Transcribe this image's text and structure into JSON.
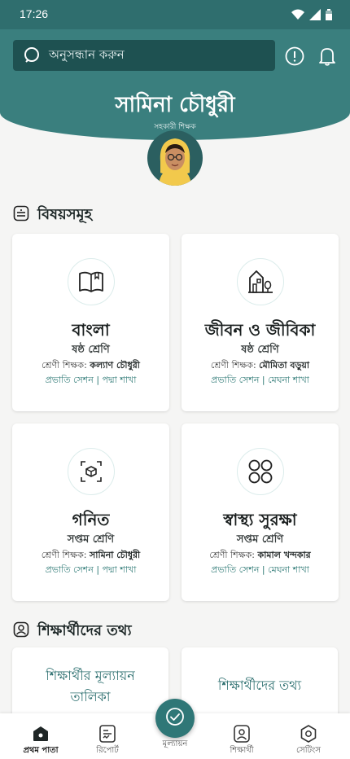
{
  "status": {
    "time": "17:26"
  },
  "header": {
    "search_placeholder": "অনুসন্ধান করুন",
    "user_name": "সামিনা চৌধুরী",
    "user_role": "সহকারী শিক্ষক"
  },
  "subjects_section": {
    "title": "বিষয়সমূহ",
    "cards": [
      {
        "icon": "book-icon",
        "title": "বাংলা",
        "grade": "ষষ্ঠ শ্রেণি",
        "teacher_label": "শ্রেণী শিক্ষক:",
        "teacher_name": "কল্যাণ চৌধুরী",
        "session": "প্রভাতি সেশন | পদ্মা শাখা"
      },
      {
        "icon": "house-tree-icon",
        "title": "জীবন ও জীবিকা",
        "grade": "ষষ্ঠ শ্রেণি",
        "teacher_label": "শ্রেণী শিক্ষক:",
        "teacher_name": "মৌমিতা বড়ুয়া",
        "session": "প্রভাতি সেশন | মেঘনা শাখা"
      },
      {
        "icon": "cube-arrows-icon",
        "title": "গনিত",
        "grade": "সপ্তম শ্রেণি",
        "teacher_label": "শ্রেণী শিক্ষক:",
        "teacher_name": "সামিনা চৌধুরী",
        "session": "প্রভাতি সেশন | পদ্মা শাখা"
      },
      {
        "icon": "four-circles-icon",
        "title": "স্বাস্থ্য সুরক্ষা",
        "grade": "সপ্তম শ্রেণি",
        "teacher_label": "শ্রেণী শিক্ষক:",
        "teacher_name": "কামাল খন্দকার",
        "session": "প্রভাতি সেশন | মেঘনা শাখা"
      }
    ]
  },
  "students_section": {
    "title": "শিক্ষার্থীদের তথ্য",
    "cards": [
      {
        "label": "শিক্ষার্থীর মূল্যায়ন তালিকা"
      },
      {
        "label": "শিক্ষার্থীদের তথ্য"
      }
    ]
  },
  "bottom_nav": {
    "items": [
      {
        "label": "প্রথম পাতা",
        "icon": "home-icon",
        "active": true
      },
      {
        "label": "রিপোর্ট",
        "icon": "report-icon"
      },
      {
        "label": "মূল্যায়ন",
        "icon": "check-circle-icon"
      },
      {
        "label": "শিক্ষার্থী",
        "icon": "student-icon"
      },
      {
        "label": "সেটিংস",
        "icon": "settings-icon"
      }
    ]
  },
  "colors": {
    "primary": "#3a7f7e",
    "dark": "#1e5151",
    "accent_text": "#2f7a76"
  }
}
